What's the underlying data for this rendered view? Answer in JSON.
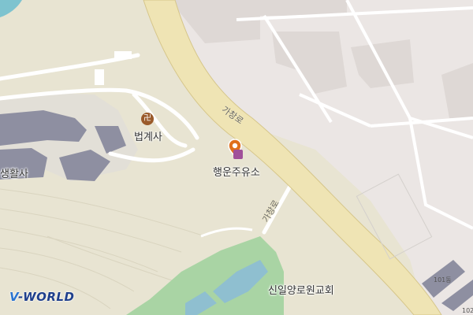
{
  "map": {
    "places": {
      "beopgyesa": "법계사",
      "saenghwalsa": "생활사",
      "haengun": "행운주유소",
      "sinil": "신일양로원교회"
    },
    "roads": {
      "gachang_main": "가창로",
      "gachang_branch": "가창로"
    },
    "buildings": {
      "b101": "101동",
      "b102": "102"
    },
    "logo": {
      "mark": "V",
      "text": "-WORLD"
    },
    "icons": {
      "temple": "temple-icon",
      "gas_station": "gas-station-pin-icon"
    },
    "colors": {
      "background": "#e8e4d2",
      "urban": "#ebe6e4",
      "main_road": "#efe4b4",
      "park": "#a9d4a4",
      "water": "#7ec3cf",
      "building": "#8e8fa1",
      "pin": "#e0701c",
      "logo": "#1f3f8c"
    }
  }
}
